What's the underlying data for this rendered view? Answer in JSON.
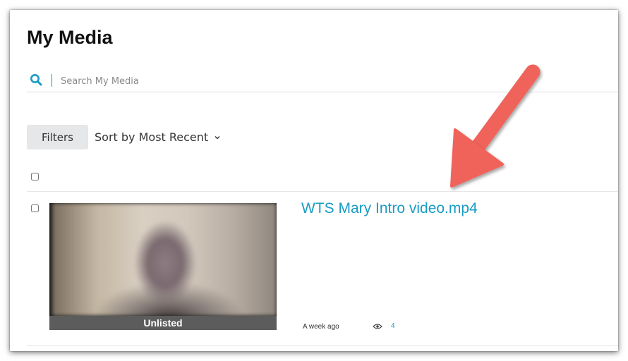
{
  "page": {
    "title": "My Media"
  },
  "search": {
    "placeholder": "Search My Media",
    "value": ""
  },
  "toolbar": {
    "filters_label": "Filters",
    "sort_label": "Sort by Most Recent"
  },
  "media_items": [
    {
      "title": "WTS Mary Intro video.mp4",
      "status": "Unlisted",
      "date": "A week ago",
      "views": "4"
    }
  ],
  "colors": {
    "accent": "#1a9cc3",
    "arrow": "#f0645a",
    "filters_bg": "#e6e7e8",
    "status_bar": "#5c5c5c"
  },
  "icons": [
    "search-icon",
    "chevron-down-icon",
    "eye-icon",
    "pointer-arrow"
  ]
}
